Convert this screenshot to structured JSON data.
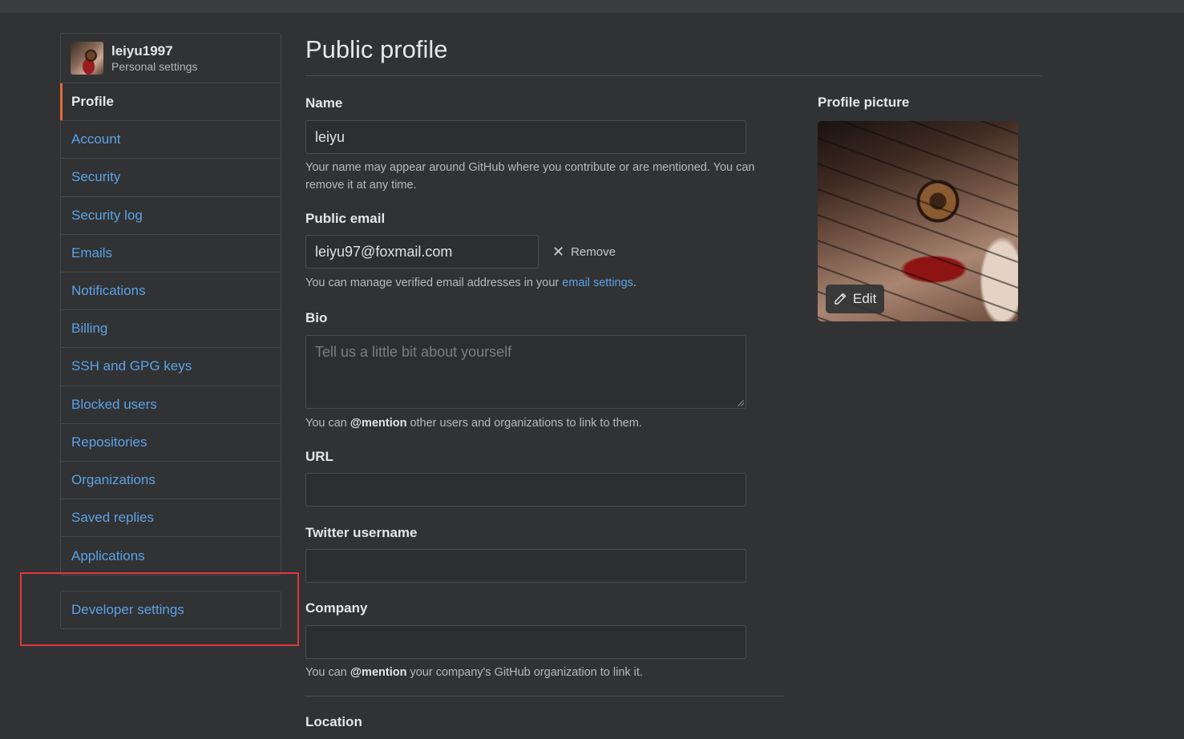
{
  "sidebar": {
    "username": "leiyu1997",
    "subtitle": "Personal settings",
    "items": [
      {
        "label": "Profile",
        "active": true
      },
      {
        "label": "Account"
      },
      {
        "label": "Security"
      },
      {
        "label": "Security log"
      },
      {
        "label": "Emails"
      },
      {
        "label": "Notifications"
      },
      {
        "label": "Billing"
      },
      {
        "label": "SSH and GPG keys"
      },
      {
        "label": "Blocked users"
      },
      {
        "label": "Repositories"
      },
      {
        "label": "Organizations"
      },
      {
        "label": "Saved replies"
      },
      {
        "label": "Applications"
      }
    ],
    "developer_settings": "Developer settings"
  },
  "main": {
    "title": "Public profile",
    "name": {
      "label": "Name",
      "value": "leiyu",
      "note": "Your name may appear around GitHub where you contribute or are mentioned. You can remove it at any time."
    },
    "email": {
      "label": "Public email",
      "value": "leiyu97@foxmail.com",
      "remove": "Remove",
      "note_prefix": "You can manage verified email addresses in your ",
      "note_link": "email settings",
      "note_suffix": "."
    },
    "bio": {
      "label": "Bio",
      "placeholder": "Tell us a little bit about yourself",
      "note_prefix": "You can ",
      "note_bold": "@mention",
      "note_suffix": " other users and organizations to link to them."
    },
    "url": {
      "label": "URL",
      "value": ""
    },
    "twitter": {
      "label": "Twitter username",
      "value": ""
    },
    "company": {
      "label": "Company",
      "value": "",
      "note_prefix": "You can ",
      "note_bold": "@mention",
      "note_suffix": " your company's GitHub organization to link it."
    },
    "location": {
      "label": "Location"
    }
  },
  "profile_picture": {
    "label": "Profile picture",
    "edit": "Edit"
  },
  "colors": {
    "background": "#313234",
    "link": "#5ba3e6",
    "active_accent": "#e36d35",
    "highlight_box": "#e0383e"
  }
}
